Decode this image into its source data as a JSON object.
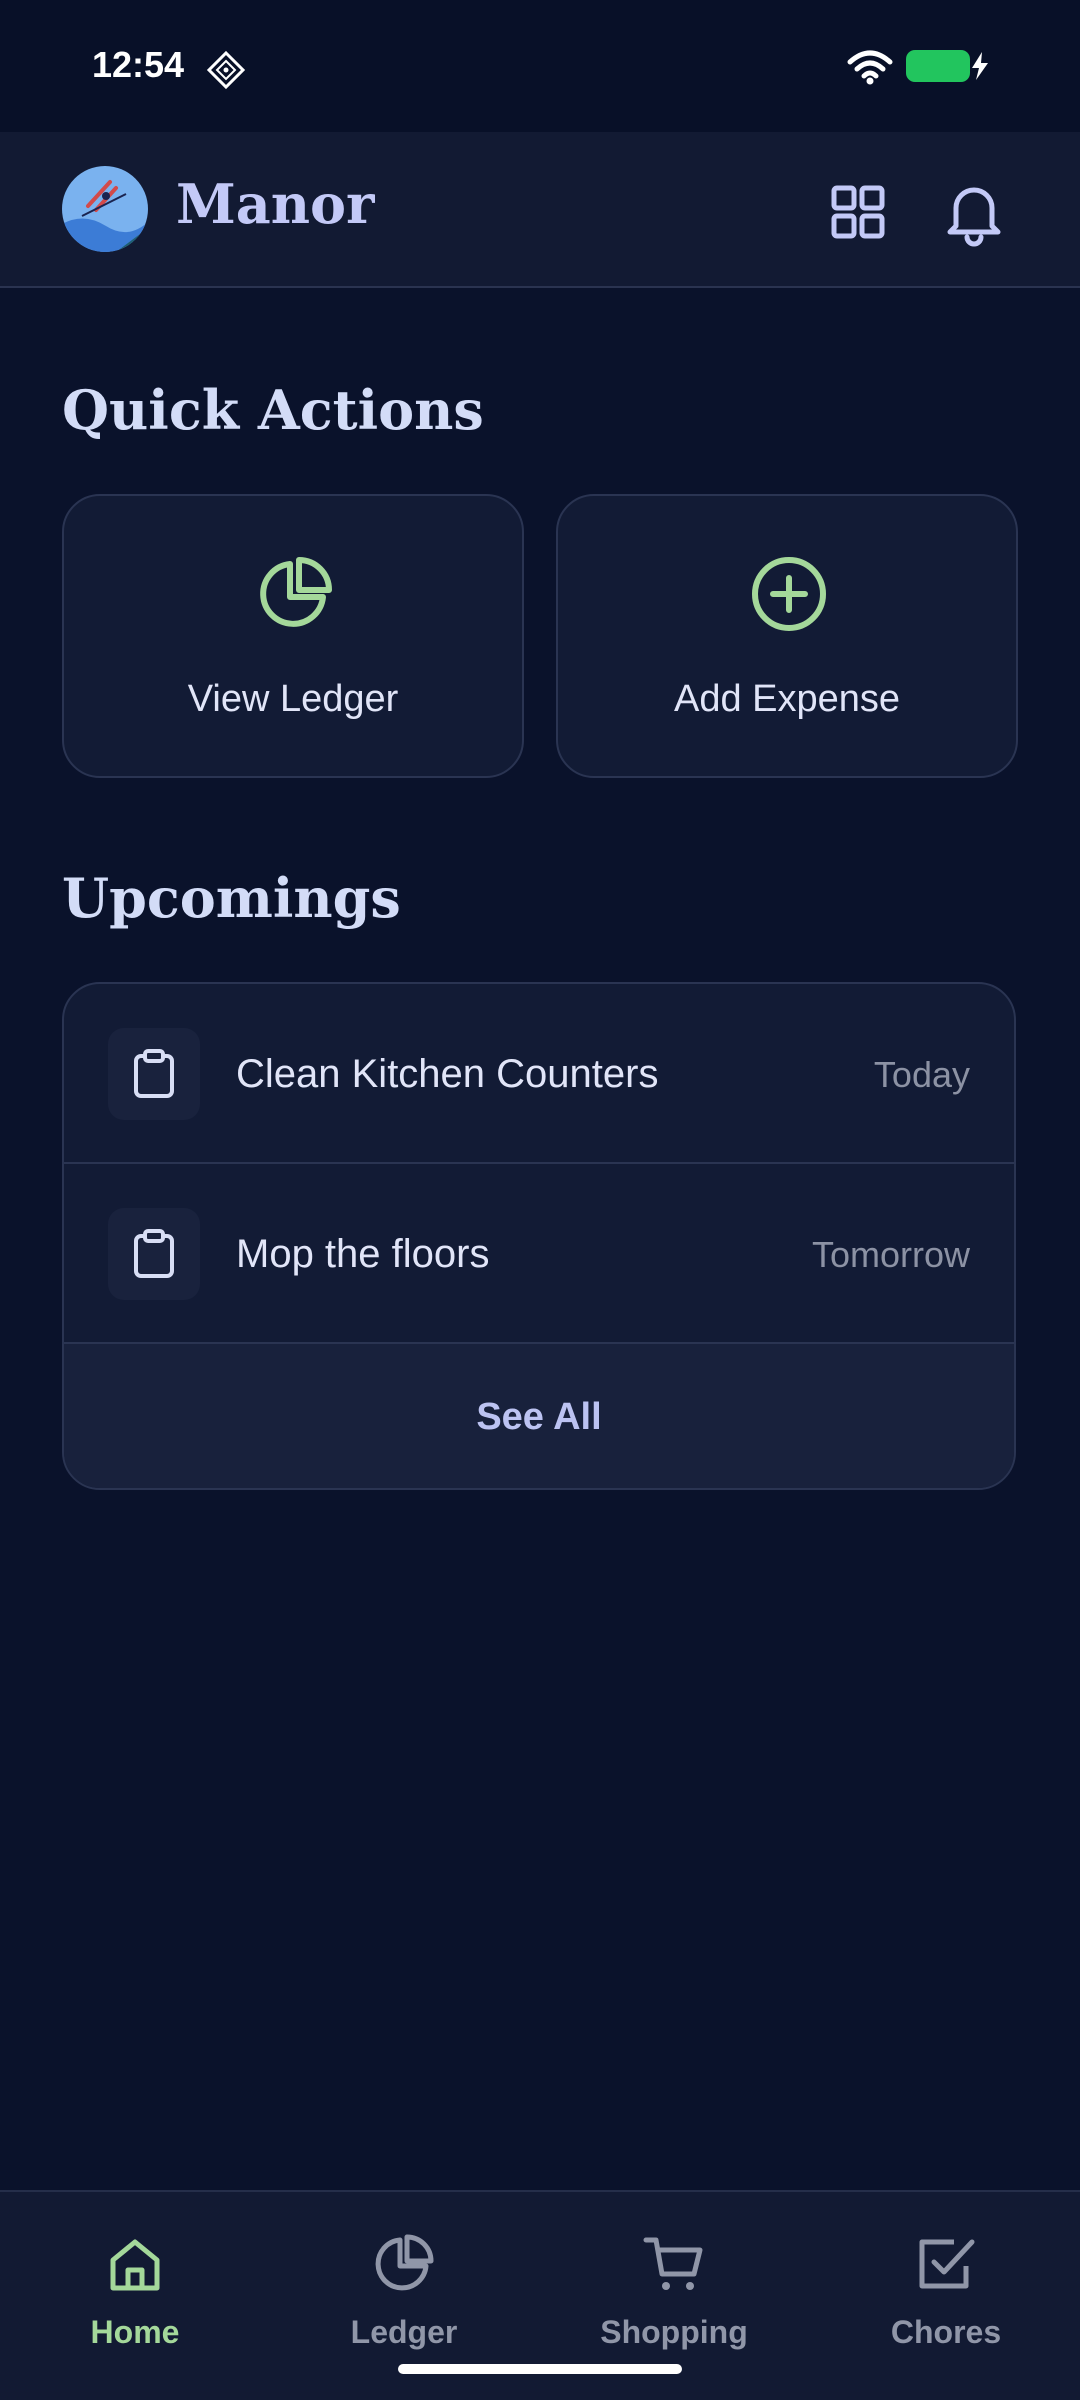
{
  "status_bar": {
    "time": "12:54"
  },
  "header": {
    "title": "Manor"
  },
  "quick_actions": {
    "title": "Quick Actions",
    "items": [
      {
        "label": "View Ledger",
        "icon": "pie-chart-icon"
      },
      {
        "label": "Add Expense",
        "icon": "plus-circle-icon"
      }
    ]
  },
  "upcomings": {
    "title": "Upcomings",
    "items": [
      {
        "title": "Clean Kitchen Counters",
        "when": "Today",
        "icon": "clipboard-icon"
      },
      {
        "title": "Mop the floors",
        "when": "Tomorrow",
        "icon": "clipboard-icon"
      }
    ],
    "see_all_label": "See All"
  },
  "bottom_nav": {
    "items": [
      {
        "label": "Home",
        "icon": "home-icon",
        "active": true
      },
      {
        "label": "Ledger",
        "icon": "pie-chart-icon",
        "active": false
      },
      {
        "label": "Shopping",
        "icon": "cart-icon",
        "active": false
      },
      {
        "label": "Chores",
        "icon": "check-square-icon",
        "active": false
      }
    ]
  },
  "colors": {
    "background": "#0a122b",
    "surface": "#121b35",
    "accent_green": "#a4d89a",
    "title_lavender": "#c3c9f7",
    "muted": "#8c92a4",
    "battery_green": "#22c55e"
  }
}
